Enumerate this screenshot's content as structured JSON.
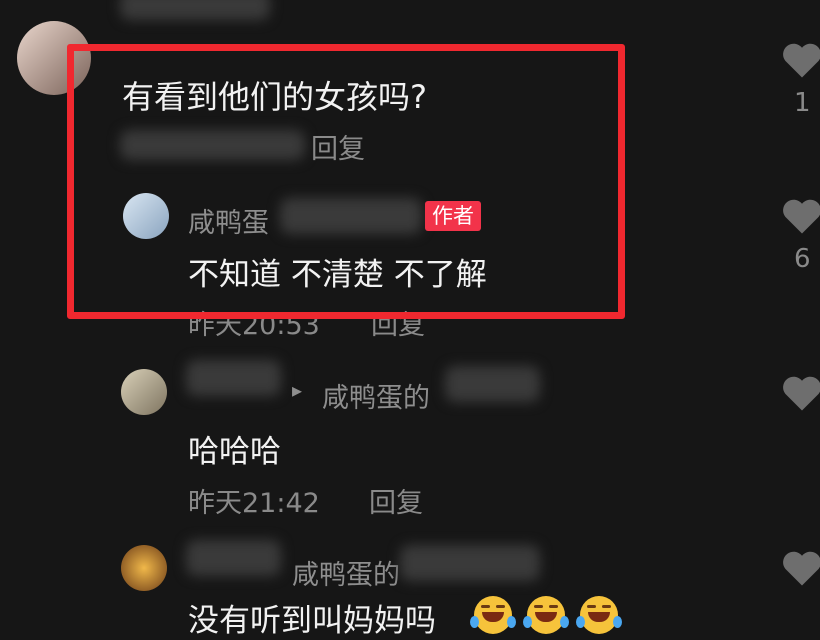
{
  "colors": {
    "background": "#161616",
    "highlight": "#f0282f",
    "badge": "#f2334a",
    "meta": "#8a8a8a"
  },
  "comment": {
    "text": "有看到他们的女孩吗?",
    "reply_label": "回复"
  },
  "author_reply": {
    "name": "咸鸭蛋",
    "badge": "作者",
    "text": "不知道 不清楚 不了解",
    "time": "昨天20:53",
    "reply_label": "回复"
  },
  "reply2": {
    "reply_to": "咸鸭蛋的",
    "arrow": "▸",
    "text": "哈哈哈",
    "time": "昨天21:42",
    "reply_label": "回复"
  },
  "reply3": {
    "reply_to": "咸鸭蛋的",
    "text": "没有听到叫妈妈吗",
    "emoji": "face-with-tears-of-joy"
  },
  "likes": [
    {
      "count": "1"
    },
    {
      "count": "6"
    },
    {
      "count": ""
    },
    {
      "count": ""
    }
  ],
  "icons": [
    "heart-icon",
    "avatar"
  ]
}
